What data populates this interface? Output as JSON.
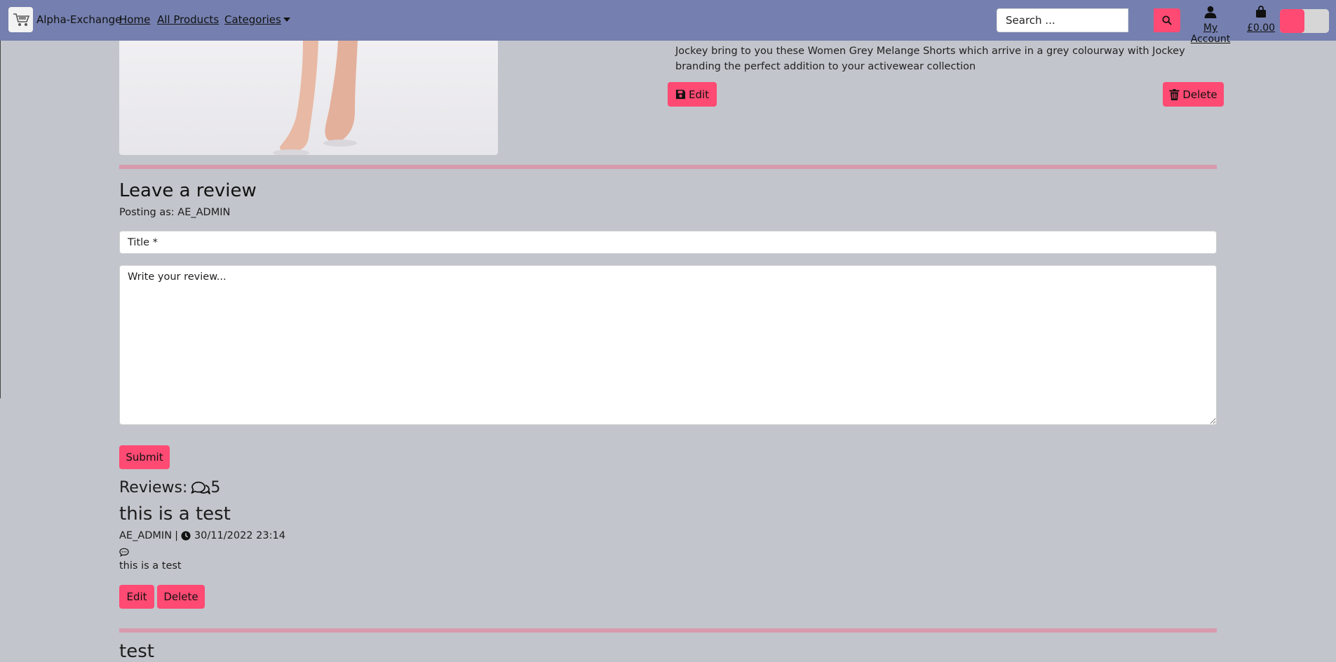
{
  "nav": {
    "brand": "Alpha-Exchange",
    "links": [
      "Home",
      "All Products",
      "Categories"
    ],
    "search_placeholder": "Search ...",
    "account_label": "My Account",
    "cart_total": "£0.00"
  },
  "product": {
    "description": "Jockey bring to you these Women Grey Melange Shorts which arrive in a grey colourway with Jockey branding the perfect addition to your activewear collection",
    "edit_label": "Edit",
    "delete_label": "Delete"
  },
  "review_form": {
    "heading": "Leave a review",
    "posting_as": "Posting as: AE_ADMIN",
    "title_placeholder": "Title *",
    "body_placeholder": "Write your review...",
    "submit_label": "Submit"
  },
  "reviews": {
    "label": "Reviews:",
    "count": "5",
    "items": [
      {
        "title": "this is a test",
        "author": "AE_ADMIN",
        "separator": "|",
        "datetime": "30/11/2022 23:14",
        "body": "this is a test",
        "edit_label": "Edit",
        "delete_label": "Delete"
      },
      {
        "title": "test"
      }
    ]
  },
  "colors": {
    "navbar": "#7580b0",
    "accent": "#ff4a73",
    "background": "#c2c5cb",
    "divider": "#d89aac"
  }
}
